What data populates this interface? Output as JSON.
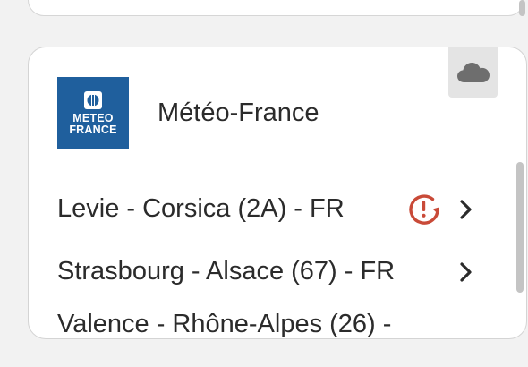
{
  "provider": {
    "name": "Météo-France",
    "logo_line1": "METEO",
    "logo_line2": "FRANCE",
    "logo_color": "#1f5f9d",
    "cloud_icon": "cloud-icon"
  },
  "locations": [
    {
      "label": "Levie - Corsica (2A) - FR",
      "has_warning": true
    },
    {
      "label": "Strasbourg - Alsace (67) - FR",
      "has_warning": false
    },
    {
      "label": "Valence - Rhône-Alpes (26) -",
      "has_warning": false
    }
  ],
  "colors": {
    "warning": "#c94a38",
    "text": "#2b2b2b",
    "card_bg": "#ffffff",
    "page_bg": "#f2f2f2"
  }
}
